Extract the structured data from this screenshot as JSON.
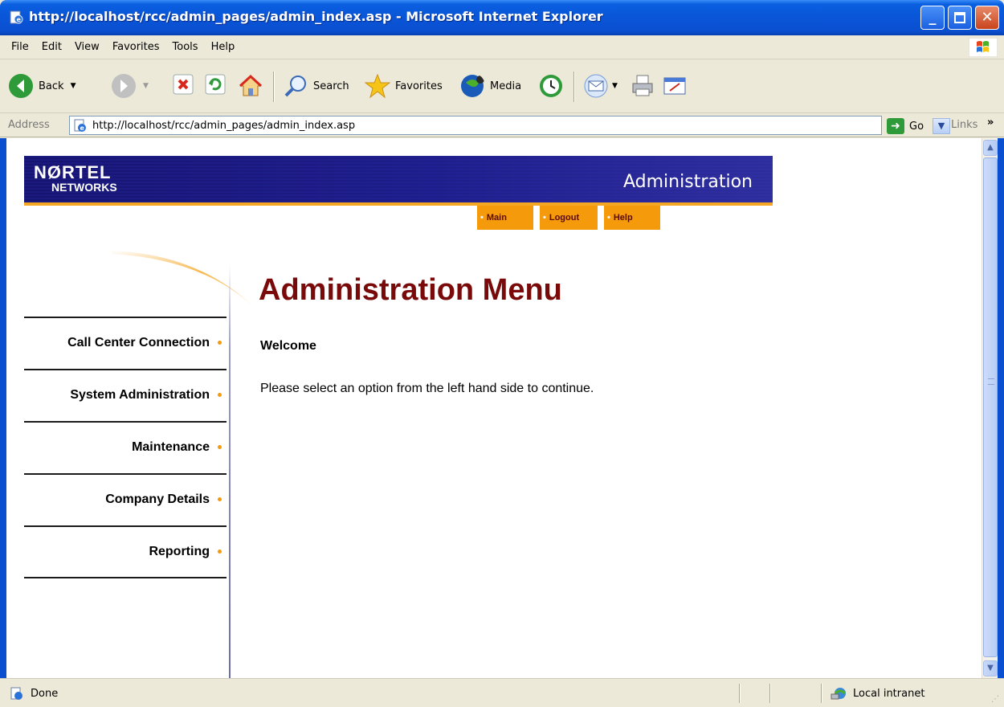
{
  "window": {
    "title": "http://localhost/rcc/admin_pages/admin_index.asp - Microsoft Internet Explorer"
  },
  "menubar": {
    "items": [
      "File",
      "Edit",
      "View",
      "Favorites",
      "Tools",
      "Help"
    ]
  },
  "toolbar": {
    "back_label": "Back",
    "search_label": "Search",
    "favorites_label": "Favorites",
    "media_label": "Media"
  },
  "addressbar": {
    "label": "Address",
    "url": "http://localhost/rcc/admin_pages/admin_index.asp",
    "go_label": "Go",
    "links_label": "Links"
  },
  "banner": {
    "logo_line1": "NØRTEL",
    "logo_line2": "NETWORKS",
    "title": "Administration"
  },
  "topnav": {
    "items": [
      "Main",
      "Logout",
      "Help"
    ]
  },
  "sidebar": {
    "items": [
      {
        "label": "Call Center Connection"
      },
      {
        "label": "System Administration"
      },
      {
        "label": "Maintenance"
      },
      {
        "label": "Company Details"
      },
      {
        "label": "Reporting"
      }
    ]
  },
  "main": {
    "heading": "Administration Menu",
    "welcome": "Welcome",
    "instruction": "Please select an option from the left hand side to continue."
  },
  "statusbar": {
    "status": "Done",
    "zone": "Local intranet"
  },
  "icons": {
    "app": "ie-page-icon",
    "back": "back-arrow-icon",
    "forward": "forward-arrow-icon",
    "stop": "stop-icon",
    "refresh": "refresh-icon",
    "home": "home-icon",
    "search": "search-icon",
    "favorites": "favorites-star-icon",
    "media": "media-icon",
    "history": "history-icon",
    "mail": "mail-icon",
    "print": "print-icon",
    "edit": "edit-icon"
  },
  "colors": {
    "accent_orange": "#f59a0a",
    "heading_red": "#7a0a0a",
    "banner_navy": "#1b1a7e",
    "titlebar_blue": "#0a55d8"
  }
}
